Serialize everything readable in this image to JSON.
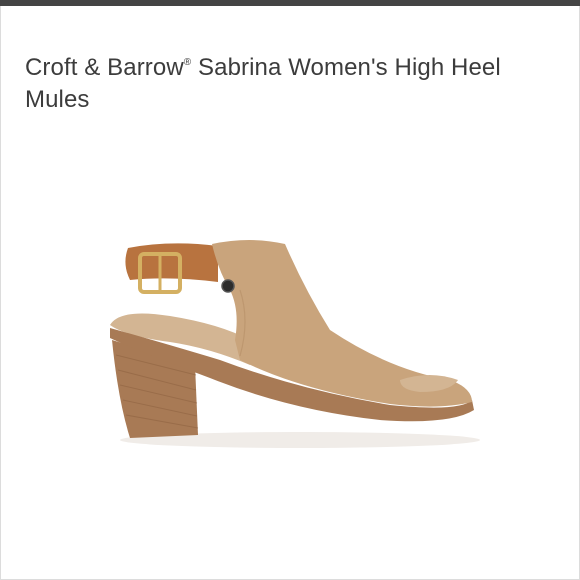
{
  "product": {
    "title_brand": "Croft & Barrow",
    "title_mark": "®",
    "title_rest": " Sabrina Women's High Heel Mules",
    "image_icon": "shoe-image",
    "colors": {
      "suede": "#c9a47c",
      "strap": "#b8733f",
      "heel": "#a87a55",
      "insole": "#d3b593",
      "buckle": "#d4b062"
    }
  }
}
